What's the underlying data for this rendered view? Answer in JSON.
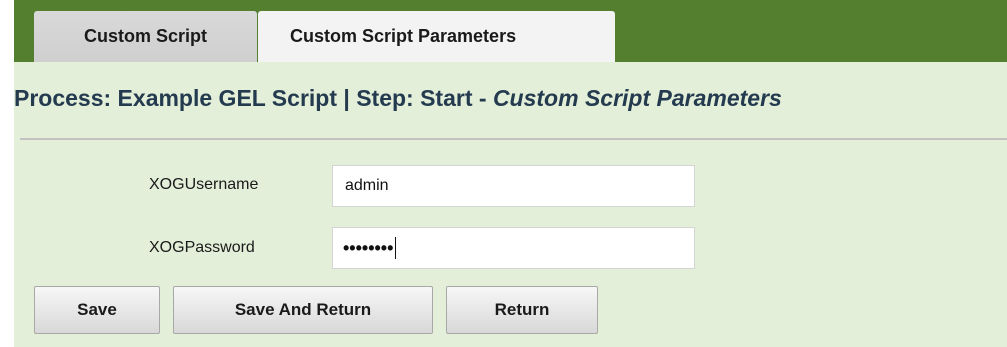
{
  "tabs": [
    {
      "label": "Custom Script",
      "active": false
    },
    {
      "label": "Custom Script Parameters",
      "active": true
    }
  ],
  "header": {
    "title_prefix": "Process: Example GEL Script | Step: Start - ",
    "title_italic": "Custom Script Parameters"
  },
  "form": {
    "username_label": "XOGUsername",
    "username_value": "admin",
    "password_label": "XOGPassword",
    "password_mask": "••••••••"
  },
  "buttons": {
    "save": "Save",
    "save_and_return": "Save And Return",
    "return": "Return"
  },
  "colors": {
    "tabbar": "#537f2f",
    "background": "#e3efd9",
    "title": "#243a4f"
  }
}
